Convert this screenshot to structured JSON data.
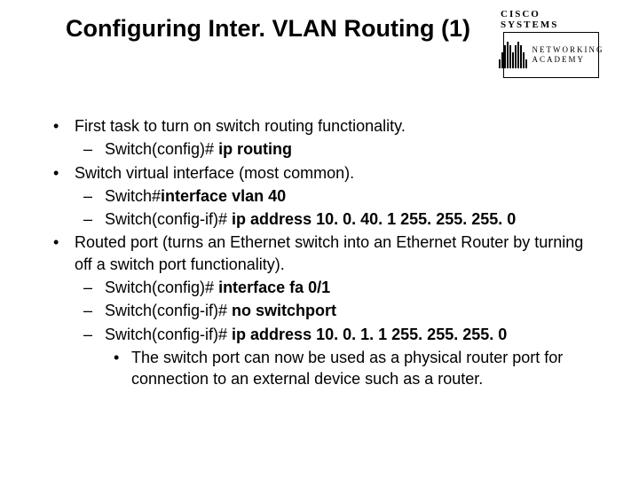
{
  "title": "Configuring Inter. VLAN Routing (1)",
  "logo": {
    "top": "CISCO SYSTEMS",
    "line1": "NETWORKING",
    "line2": "ACADEMY"
  },
  "bullets": {
    "b1": {
      "text": "First task to turn on switch routing functionality.",
      "sub1_pre": "Switch(config)# ",
      "sub1_bold": "ip routing"
    },
    "b2": {
      "text": "Switch virtual interface (most common).",
      "sub1_pre": "Switch#",
      "sub1_bold": "interface vlan 40",
      "sub2_pre": "Switch(config-if)# ",
      "sub2_bold": "ip address 10. 0. 40. 1 255. 255. 255. 0"
    },
    "b3": {
      "text": "Routed port (turns an Ethernet switch into an Ethernet Router by turning off a switch port functionality).",
      "sub1_pre": "Switch(config)# ",
      "sub1_bold": "interface fa 0/1",
      "sub2_pre": "Switch(config-if)# ",
      "sub2_bold": "no switchport",
      "sub3_pre": "Switch(config-if)# ",
      "sub3_bold": "ip address 10. 0. 1. 1 255. 255. 255. 0",
      "note": "The switch port can now be used as a physical router port for connection to an external device such as a router."
    }
  }
}
